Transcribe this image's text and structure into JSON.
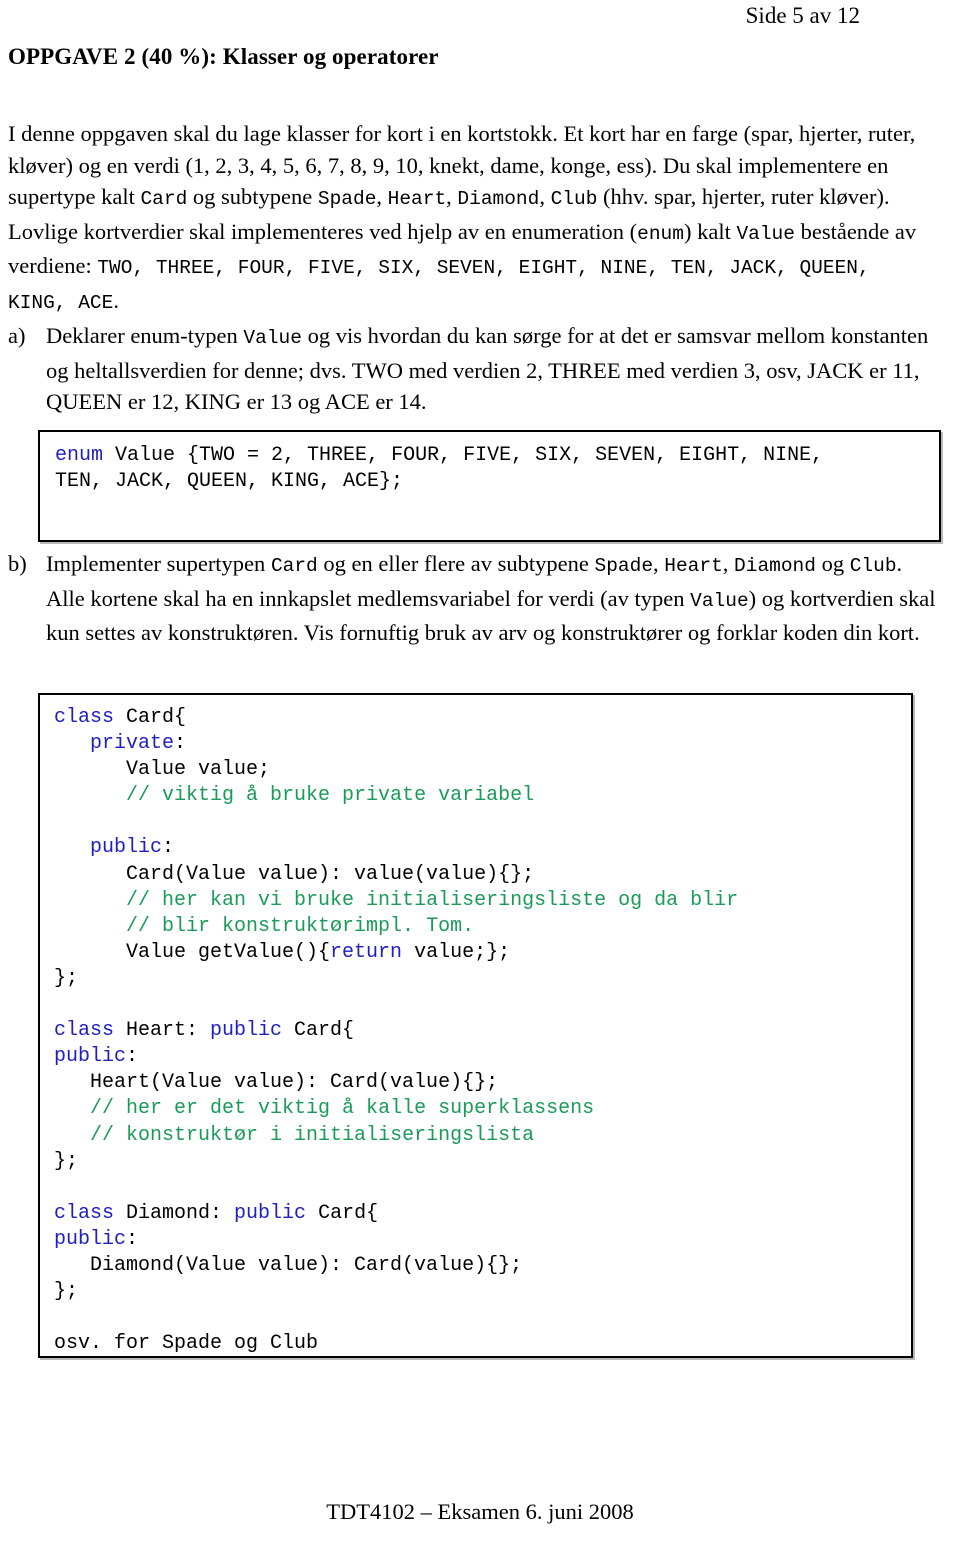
{
  "header": {
    "page_indicator": "Side 5 av 12"
  },
  "title": {
    "text": "OPPGAVE 2 (40 %):  Klasser og operatorer"
  },
  "intro": {
    "segments": [
      {
        "t": "I denne oppgaven skal du lage klasser for kort i en kortstokk. Et kort har en farge (spar, hjerter, ruter, kløver) og en verdi (1, 2, 3, 4, 5, 6, 7, 8, 9, 10, knekt, dame, konge, ess). Du skal implementere en supertype kalt ",
        "mono": false
      },
      {
        "t": "Card",
        "mono": true
      },
      {
        "t": " og subtypene ",
        "mono": false
      },
      {
        "t": "Spade",
        "mono": true
      },
      {
        "t": ", ",
        "mono": false
      },
      {
        "t": "Heart",
        "mono": true
      },
      {
        "t": ", ",
        "mono": false
      },
      {
        "t": "Diamond",
        "mono": true
      },
      {
        "t": ", ",
        "mono": false
      },
      {
        "t": "Club",
        "mono": true
      },
      {
        "t": " (hhv. spar, hjerter, ruter kløver). Lovlige kortverdier skal implementeres ved hjelp av en enumeration (",
        "mono": false
      },
      {
        "t": "enum",
        "mono": true
      },
      {
        "t": ") kalt ",
        "mono": false
      },
      {
        "t": "Value",
        "mono": true
      },
      {
        "t": " bestående av verdiene: ",
        "mono": false
      },
      {
        "t": "TWO, THREE, FOUR, FIVE, SIX, SEVEN, EIGHT, NINE, TEN, JACK, QUEEN, KING, ACE",
        "mono": true
      },
      {
        "t": ".",
        "mono": false
      }
    ]
  },
  "item_a": {
    "label": "a)",
    "segments": [
      {
        "t": "Deklarer enum-typen ",
        "mono": false
      },
      {
        "t": "Value",
        "mono": true
      },
      {
        "t": " og vis hvordan du kan sørge for at det er samsvar mellom konstanten og heltallsverdien for denne; dvs. TWO med verdien 2, THREE med verdien 3, osv, JACK er 11, QUEEN er 12, KING er 13 og ACE er 14.",
        "mono": false
      }
    ]
  },
  "item_b": {
    "label": "b)",
    "segments": [
      {
        "t": "Implementer supertypen ",
        "mono": false
      },
      {
        "t": "Card",
        "mono": true
      },
      {
        "t": " og en eller flere av subtypene ",
        "mono": false
      },
      {
        "t": "Spade",
        "mono": true
      },
      {
        "t": ", ",
        "mono": false
      },
      {
        "t": "Heart",
        "mono": true
      },
      {
        "t": ", ",
        "mono": false
      },
      {
        "t": "Diamond",
        "mono": true
      },
      {
        "t": " og ",
        "mono": false
      },
      {
        "t": "Club",
        "mono": true
      },
      {
        "t": ". Alle kortene skal ha en innkapslet medlemsvariabel for verdi (av typen ",
        "mono": false
      },
      {
        "t": "Value",
        "mono": true
      },
      {
        "t": ") og kortverdien skal kun settes av konstruktøren. Vis fornuftig bruk av arv og konstruktører og forklar koden din kort.",
        "mono": false
      }
    ]
  },
  "enum_code": {
    "lines": [
      [
        {
          "t": "enum",
          "c": "kw"
        },
        {
          "t": " Value {TWO = 2, THREE, FOUR, FIVE, SIX, SEVEN, EIGHT, NINE,",
          "c": ""
        }
      ],
      [
        {
          "t": "TEN, JACK, QUEEN, KING, ACE};",
          "c": ""
        }
      ],
      [
        {
          "t": "",
          "c": ""
        }
      ],
      [
        {
          "t": "",
          "c": ""
        }
      ]
    ]
  },
  "class_code": {
    "lines": [
      [
        {
          "t": "class",
          "c": "kw"
        },
        {
          "t": " Card{",
          "c": ""
        }
      ],
      [
        {
          "t": "   ",
          "c": ""
        },
        {
          "t": "private",
          "c": "kw"
        },
        {
          "t": ":",
          "c": ""
        }
      ],
      [
        {
          "t": "      Value value;",
          "c": ""
        }
      ],
      [
        {
          "t": "      ",
          "c": ""
        },
        {
          "t": "// viktig å bruke private variabel",
          "c": "cmt"
        }
      ],
      [
        {
          "t": "",
          "c": ""
        }
      ],
      [
        {
          "t": "   ",
          "c": ""
        },
        {
          "t": "public",
          "c": "kw"
        },
        {
          "t": ":",
          "c": ""
        }
      ],
      [
        {
          "t": "      Card(Value value): value(value){};",
          "c": ""
        }
      ],
      [
        {
          "t": "      ",
          "c": ""
        },
        {
          "t": "// her kan vi bruke initialiseringsliste og da blir",
          "c": "cmt"
        }
      ],
      [
        {
          "t": "      ",
          "c": ""
        },
        {
          "t": "// blir konstruktørimpl. Tom.",
          "c": "cmt"
        }
      ],
      [
        {
          "t": "      Value getValue(){",
          "c": ""
        },
        {
          "t": "return",
          "c": "kw"
        },
        {
          "t": " value;};",
          "c": ""
        }
      ],
      [
        {
          "t": "};",
          "c": ""
        }
      ],
      [
        {
          "t": "",
          "c": ""
        }
      ],
      [
        {
          "t": "class",
          "c": "kw"
        },
        {
          "t": " Heart: ",
          "c": ""
        },
        {
          "t": "public",
          "c": "kw"
        },
        {
          "t": " Card{",
          "c": ""
        }
      ],
      [
        {
          "t": "public",
          "c": "kw"
        },
        {
          "t": ":",
          "c": ""
        }
      ],
      [
        {
          "t": "   Heart(Value value): Card(value){};",
          "c": ""
        }
      ],
      [
        {
          "t": "   ",
          "c": ""
        },
        {
          "t": "// her er det viktig å kalle superklassens",
          "c": "cmt"
        }
      ],
      [
        {
          "t": "   ",
          "c": ""
        },
        {
          "t": "// konstruktør i initialiseringslista",
          "c": "cmt"
        }
      ],
      [
        {
          "t": "};",
          "c": ""
        }
      ],
      [
        {
          "t": "",
          "c": ""
        }
      ],
      [
        {
          "t": "class",
          "c": "kw"
        },
        {
          "t": " Diamond: ",
          "c": ""
        },
        {
          "t": "public",
          "c": "kw"
        },
        {
          "t": " Card{",
          "c": ""
        }
      ],
      [
        {
          "t": "public",
          "c": "kw"
        },
        {
          "t": ":",
          "c": ""
        }
      ],
      [
        {
          "t": "   Diamond(Value value): Card(value){};",
          "c": ""
        }
      ],
      [
        {
          "t": "};",
          "c": ""
        }
      ],
      [
        {
          "t": "",
          "c": ""
        }
      ],
      [
        {
          "t": "osv. for Spade og Club",
          "c": ""
        }
      ]
    ]
  },
  "footer": {
    "text": "TDT4102 – Eksamen 6. juni 2008"
  },
  "colors": {
    "keyword_blue": "#2020c0",
    "comment_green": "#1a9b58",
    "border": "#000000",
    "text": "#000000",
    "background": "#ffffff"
  }
}
